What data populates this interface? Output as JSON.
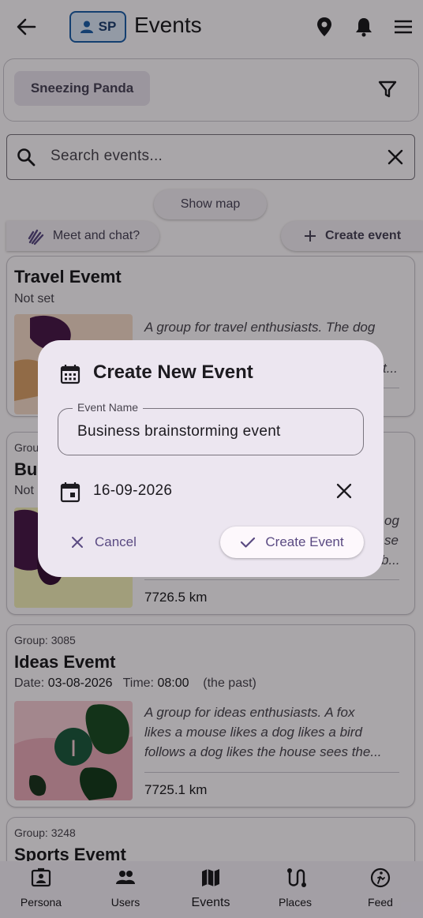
{
  "app_bar": {
    "title": "Events",
    "persona_initials": "SP"
  },
  "filter": {
    "chip_label": "Sneezing Panda"
  },
  "search": {
    "placeholder": "Search events..."
  },
  "actions": {
    "show_map": "Show map",
    "meet_chat": "Meet and chat?",
    "create_event": "Create event"
  },
  "events": [
    {
      "title": "Travel Evemt",
      "date_text": "Not set",
      "description": "A group for travel enthusiasts. The dog",
      "thumb_color": "#f3d9c8"
    },
    {
      "group": "Grou",
      "title": "Bus",
      "date_text": "Not",
      "description_fragments": [
        "og",
        "se",
        "b..."
      ],
      "distance": "7726.5 km",
      "thumb_color": "#f0ecb8"
    },
    {
      "group": "Group: 3085",
      "title": "Ideas Evemt",
      "date_label": "Date:",
      "date_value": "03-08-2026",
      "time_label": "Time:",
      "time_value": "08:00",
      "when_note": "(the past)",
      "description_lines": [
        "A group for ideas enthusiasts. A fox",
        "likes a mouse likes a dog likes a bird",
        "follows a dog likes the house sees the..."
      ],
      "distance": "7725.1 km",
      "thumb_letter": "I",
      "thumb_color": "#f3c9d3"
    },
    {
      "group": "Group: 3248",
      "title": "Sports Evemt"
    }
  ],
  "bottom_nav": [
    {
      "label": "Persona",
      "icon": "persona-icon"
    },
    {
      "label": "Users",
      "icon": "users-icon"
    },
    {
      "label": "Events",
      "icon": "map-icon",
      "active": true
    },
    {
      "label": "Places",
      "icon": "route-icon"
    },
    {
      "label": "Feed",
      "icon": "feed-icon"
    }
  ],
  "dialog": {
    "title": "Create New Event",
    "name_label": "Event Name",
    "name_value": "Business brainstorming event",
    "date_value": "16-09-2026",
    "cancel_label": "Cancel",
    "create_label": "Create Event"
  },
  "colors": {
    "accent": "#5a4a82",
    "scrim": "rgba(0,0,0,0.33)",
    "dialog_bg": "#ece6f0"
  }
}
